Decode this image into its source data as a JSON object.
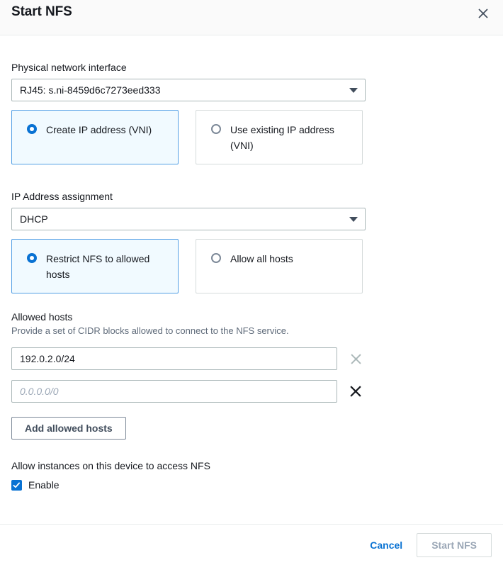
{
  "modal": {
    "title": "Start NFS",
    "close_icon": "close-icon"
  },
  "physical_interface": {
    "label": "Physical network interface",
    "selected": "RJ45: s.ni-8459d6c7273eed333",
    "caret_icon": "chevron-down-icon"
  },
  "ip_mode": {
    "options": [
      {
        "label": "Create IP address (VNI)",
        "selected": true
      },
      {
        "label": "Use existing IP address (VNI)",
        "selected": false
      }
    ]
  },
  "ip_assignment": {
    "label": "IP Address assignment",
    "selected": "DHCP",
    "caret_icon": "chevron-down-icon"
  },
  "host_mode": {
    "options": [
      {
        "label": "Restrict NFS to allowed hosts",
        "selected": true
      },
      {
        "label": "Allow all hosts",
        "selected": false
      }
    ]
  },
  "allowed_hosts": {
    "title": "Allowed hosts",
    "description": "Provide a set of CIDR blocks allowed to connect to the NFS service.",
    "rows": [
      {
        "value": "192.0.2.0/24",
        "placeholder": "0.0.0.0/0",
        "remove_icon": "close-icon",
        "remove_muted": true
      },
      {
        "value": "",
        "placeholder": "0.0.0.0/0",
        "remove_icon": "close-icon",
        "remove_muted": false
      }
    ],
    "add_button": "Add allowed hosts"
  },
  "instance_access": {
    "label": "Allow instances on this device to access NFS",
    "checkbox_label": "Enable",
    "checked": true
  },
  "footer": {
    "cancel_label": "Cancel",
    "submit_label": "Start NFS",
    "submit_disabled": true
  },
  "colors": {
    "accent": "#0972d3",
    "selected_tile_border": "#539fe5",
    "selected_tile_bg": "#f1faff",
    "text": "#16191f",
    "muted_text": "#5f6b7a",
    "disabled_text": "#9ba7b6",
    "border": "#aab7b8",
    "divider": "#eaeded",
    "header_bg": "#fafafa"
  }
}
